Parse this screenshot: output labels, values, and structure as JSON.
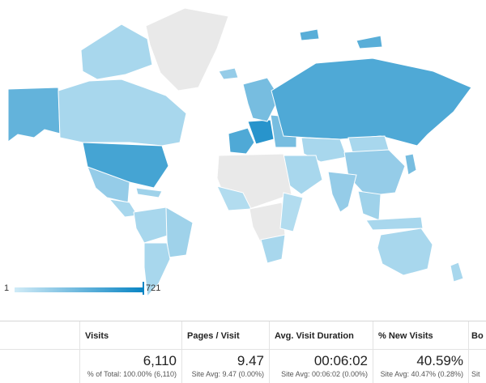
{
  "colors": {
    "no_data": "#e9e9e9",
    "low": "#d0ebf7",
    "high": "#0a85c4",
    "border": "#ffffff"
  },
  "map": {
    "metric": "Visits",
    "scale_min": "1",
    "scale_max": "721",
    "regions": [
      {
        "name": "Alaska",
        "level": 0.55
      },
      {
        "name": "Canada",
        "level": 0.2
      },
      {
        "name": "Canadian Arctic",
        "level": 0.2
      },
      {
        "name": "Greenland",
        "level": 0
      },
      {
        "name": "Iceland",
        "level": 0.3
      },
      {
        "name": "United States",
        "level": 0.7
      },
      {
        "name": "Mexico",
        "level": 0.3
      },
      {
        "name": "Central America",
        "level": 0.2
      },
      {
        "name": "Caribbean",
        "level": 0.25
      },
      {
        "name": "South America North",
        "level": 0.2
      },
      {
        "name": "Brazil",
        "level": 0.25
      },
      {
        "name": "South America South",
        "level": 0.2
      },
      {
        "name": "Western Europe",
        "level": 0.65
      },
      {
        "name": "Central Europe",
        "level": 0.85
      },
      {
        "name": "Eastern Europe",
        "level": 0.45
      },
      {
        "name": "Scandinavia",
        "level": 0.45
      },
      {
        "name": "Russia",
        "level": 0.65
      },
      {
        "name": "Russian Arctic Islands",
        "level": 0.6
      },
      {
        "name": "Kazakhstan",
        "level": 0.2
      },
      {
        "name": "Mongolia",
        "level": 0.2
      },
      {
        "name": "China",
        "level": 0.3
      },
      {
        "name": "Japan",
        "level": 0.45
      },
      {
        "name": "Middle East",
        "level": 0.2
      },
      {
        "name": "North Africa",
        "level": 0
      },
      {
        "name": "West Africa",
        "level": 0.15
      },
      {
        "name": "Central Africa",
        "level": 0
      },
      {
        "name": "East Africa",
        "level": 0.15
      },
      {
        "name": "Southern Africa",
        "level": 0.2
      },
      {
        "name": "India",
        "level": 0.3
      },
      {
        "name": "Southeast Asia",
        "level": 0.25
      },
      {
        "name": "Indonesia",
        "level": 0.2
      },
      {
        "name": "Australia",
        "level": 0.2
      },
      {
        "name": "New Zealand",
        "level": 0.2
      }
    ]
  },
  "table": {
    "columns": [
      "",
      "Visits",
      "Pages / Visit",
      "Avg. Visit Duration",
      "% New Visits",
      "Bo"
    ],
    "totals": [
      {
        "value": "",
        "sub": ""
      },
      {
        "value": "6,110",
        "sub": "% of Total: 100.00% (6,110)"
      },
      {
        "value": "9.47",
        "sub": "Site Avg: 9.47 (0.00%)"
      },
      {
        "value": "00:06:02",
        "sub": "Site Avg: 00:06:02 (0.00%)"
      },
      {
        "value": "40.59%",
        "sub": "Site Avg: 40.47% (0.28%)"
      },
      {
        "value": "",
        "sub": "Sit"
      }
    ]
  }
}
